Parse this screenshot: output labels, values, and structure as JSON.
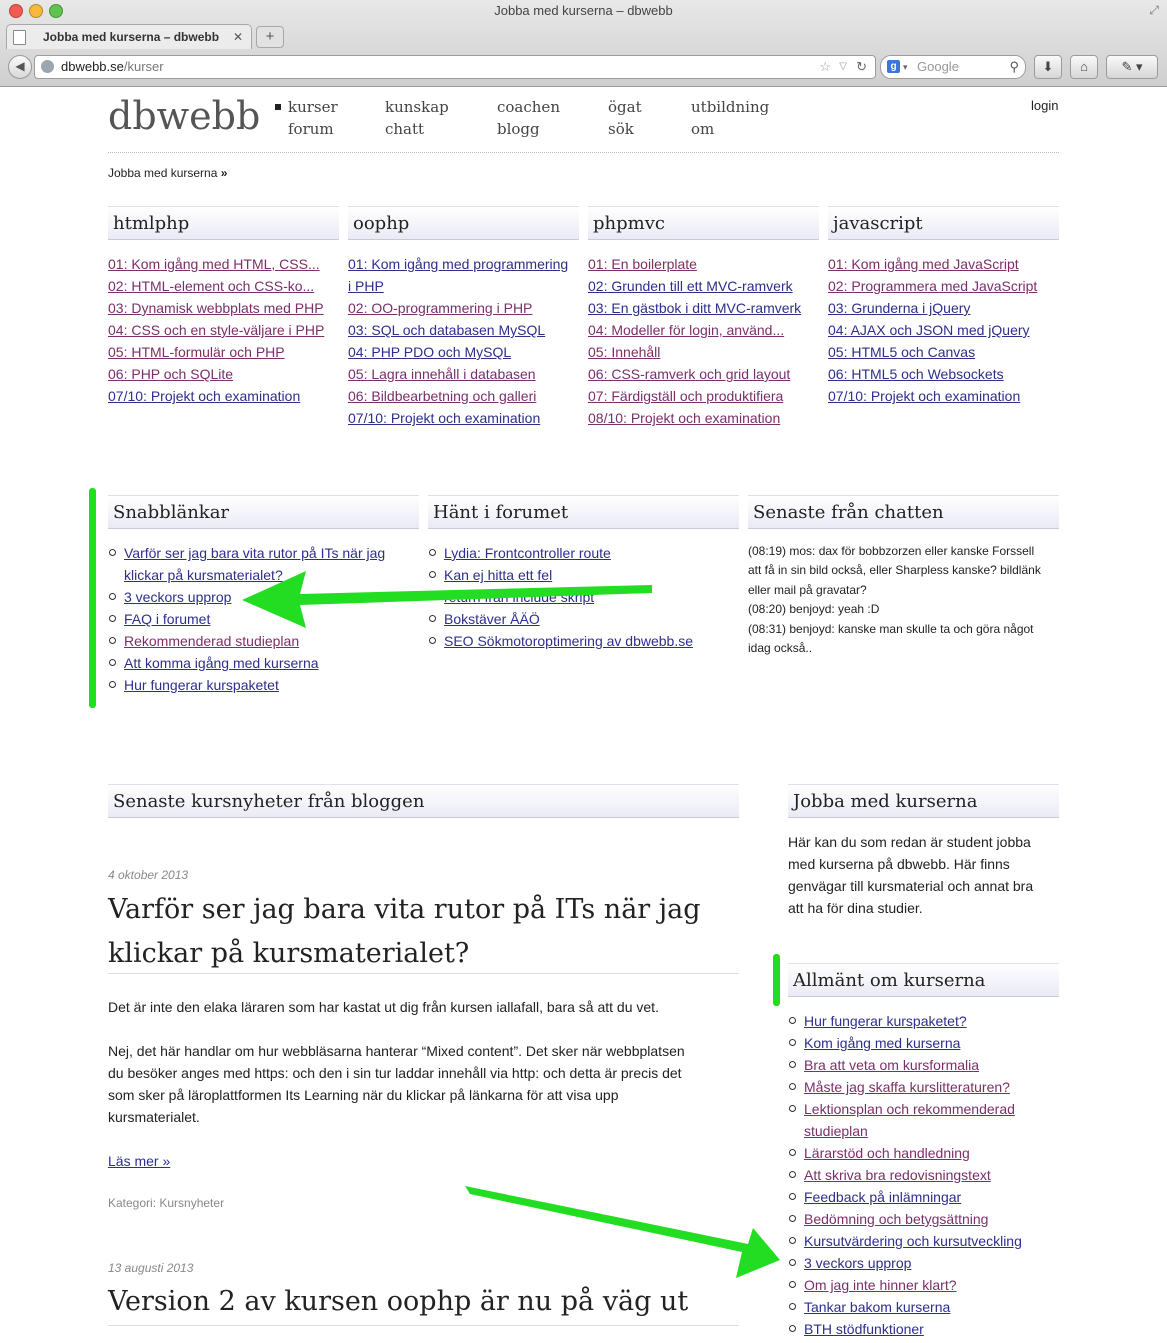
{
  "browser": {
    "window_title": "Jobba med kurserna – dbwebb",
    "tab_title": "Jobba med kurserna – dbwebb",
    "new_tab": "+",
    "url_host": "dbwebb.se",
    "url_path": "/kurser",
    "search_placeholder": "Google"
  },
  "site": {
    "logo": "dbwebb",
    "nav": [
      {
        "label": "kurser"
      },
      {
        "label": "forum"
      },
      {
        "label": "kunskap"
      },
      {
        "label": "chatt"
      },
      {
        "label": "coachen"
      },
      {
        "label": "blogg"
      },
      {
        "label": "ögat"
      },
      {
        "label": "sök"
      },
      {
        "label": "utbildning"
      },
      {
        "label": "om"
      }
    ],
    "login": "login",
    "breadcrumb": "Jobba med kurserna",
    "breadcrumb_sep": "»"
  },
  "courses": [
    {
      "title": "htmlphp",
      "links": [
        "01: Kom igång med HTML, CSS...",
        "02: HTML-element och CSS-ko...",
        "03: Dynamisk webbplats med PHP",
        "04: CSS och en style-väljare i PHP",
        "05: HTML-formulär och PHP",
        "06: PHP och SQLite",
        "07/10: Projekt och examination"
      ]
    },
    {
      "title": "oophp",
      "links": [
        "01: Kom igång med programmering",
        "i PHP",
        "02: OO-programmering i PHP",
        "03: SQL och databasen MySQL",
        "04: PHP PDO och MySQL",
        "05: Lagra innehåll i databasen",
        "06: Bildbearbetning och galleri",
        "07/10: Projekt och examination"
      ]
    },
    {
      "title": "phpmvc",
      "links": [
        "01: En boilerplate",
        "02: Grunden till ett MVC-ramverk",
        "03: En gästbok i ditt MVC-ramverk",
        "04: Modeller för login, använd...",
        "05: Innehåll",
        "06: CSS-ramverk och grid layout",
        "07: Färdigställ och produktifiera",
        "08/10: Projekt och examination"
      ]
    },
    {
      "title": "javascript",
      "links": [
        "01: Kom igång med JavaScript",
        "02: Programmera med JavaScript",
        "03: Grunderna i jQuery",
        "04: AJAX och JSON med jQuery",
        "05: HTML5 och Canvas",
        "06: HTML5 och Websockets",
        "07/10: Projekt och examination"
      ]
    }
  ],
  "quicklinks": {
    "title": "Snabblänkar",
    "items": [
      "Varför ser jag bara vita rutor på ITs när jag",
      "klickar på kursmaterialet?",
      "3 veckors upprop",
      "FAQ i forumet",
      "Rekommenderad studieplan",
      "Att komma igång med kurserna",
      "Hur fungerar kurspaketet"
    ]
  },
  "forum": {
    "title": "Hänt i forumet",
    "items": [
      "Lydia: Frontcontroller route",
      "Kan ej hitta ett fel",
      "return från include skript",
      "Bokstäver ÅÄÖ",
      "SEO Sökmotoroptimering av dbwebb.se"
    ]
  },
  "chat": {
    "title": "Senaste från chatten",
    "lines": [
      "(08:19) mos: dax för bobbzorzen eller kanske Forssell",
      "att få in sin bild också, eller Sharpless kanske? bildlänk",
      "eller mail på gravatar?",
      "(08:20) benjoyd: yeah :D",
      "(08:31) benjoyd: kanske man skulle ta och göra något",
      "idag också.."
    ]
  },
  "blog": {
    "title": "Senaste kursnyheter från bloggen",
    "post1": {
      "date": "4 oktober 2013",
      "title_line1": "Varför ser jag bara vita rutor på ITs när jag",
      "title_line2": "klickar på kursmaterialet?",
      "para1": "Det är inte den elaka läraren som har kastat ut dig från kursen iallafall, bara så att du vet.",
      "para2_lines": [
        "Nej, det här handlar om hur webbläsarna hanterar “Mixed content”. Det sker när webbplatsen",
        "du besöker anges med https: och den i sin tur laddar innehåll via http: och detta är precis det",
        "som sker på läroplattformen Its Learning när du klickar på länkarna för att visa upp",
        "kursmaterialet."
      ],
      "read_more": "Läs mer »",
      "category": "Kategori: Kursnyheter"
    },
    "post2": {
      "date": "13 augusti 2013",
      "title": "Version 2 av kursen oophp är nu på väg ut"
    }
  },
  "sidebar": {
    "intro_title": "Jobba med kurserna",
    "intro_lines": [
      "Här kan du som redan är student jobba",
      "med kurserna på dbwebb. Här finns",
      "genvägar till kursmaterial och annat bra",
      "att ha för dina studier."
    ],
    "general_title": "Allmänt om kurserna",
    "items": [
      "Hur fungerar kurspaketet?",
      "Kom igång med kurserna",
      "Bra att veta om kursformalia",
      "Måste jag skaffa kurslitteraturen?",
      "Lektionsplan och rekommenderad",
      "studieplan",
      "Lärarstöd och handledning",
      "Att skriva bra redovisningstext",
      "Feedback på inlämningar",
      "Bedömning och betygsättning",
      "Kursutvärdering och kursutveckling",
      "3 veckors upprop",
      "Om jag inte hinner klart?",
      "Tankar bakom kurserna",
      "BTH stödfunktioner"
    ]
  },
  "colors": {
    "annotation_green": "#22dd22",
    "link": "#2d2f8a",
    "visited": "#7a2f6a"
  }
}
